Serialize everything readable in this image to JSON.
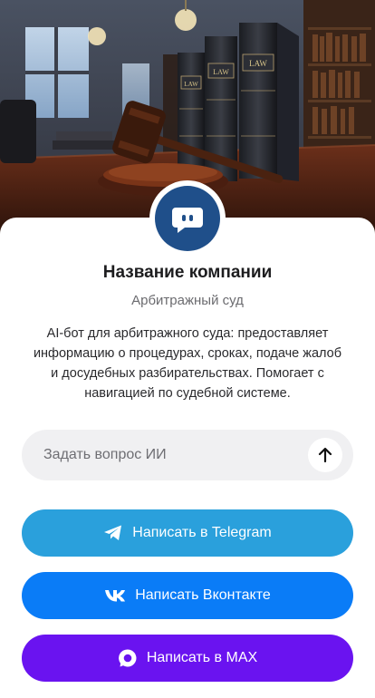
{
  "hero": {
    "image": "courtroom-gavel-law-books",
    "book_label": "LAW"
  },
  "company": {
    "name": "Название компании",
    "category": "Арбитражный суд",
    "description": "AI-бот для арбитражного суда: предоставляет информацию о процедурах, сроках, подаче жалоб и досудебных разбирательствах. Помогает с навигацией по судебной системе.",
    "avatar_icon": "chat-bot-icon",
    "avatar_color": "#1f4f8a"
  },
  "ask": {
    "placeholder": "Задать вопрос ИИ",
    "send_icon": "arrow-up-icon"
  },
  "buttons": {
    "telegram": {
      "label": "Написать в Telegram",
      "icon": "telegram-icon",
      "color": "#2aa0dc"
    },
    "vk": {
      "label": "Написать Вконтакте",
      "icon": "vk-icon",
      "color": "#0a7cf7"
    },
    "max": {
      "label": "Написать в MAX",
      "icon": "max-icon",
      "color": "#6a13f0"
    }
  }
}
